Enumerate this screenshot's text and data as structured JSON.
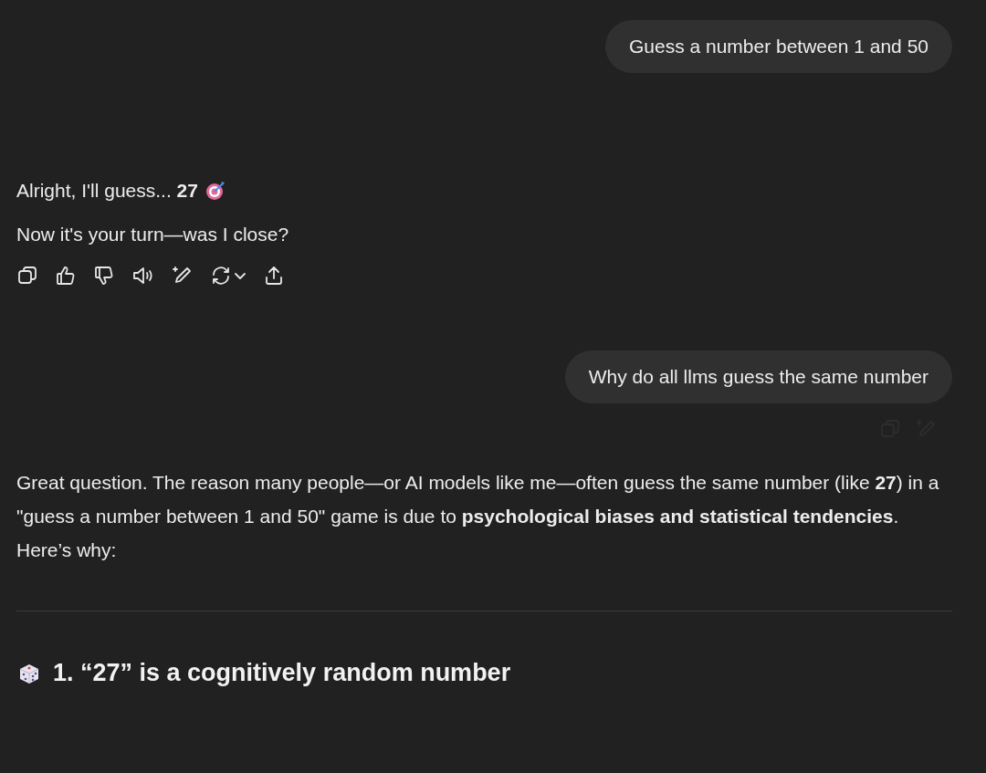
{
  "conversation": [
    {
      "kind": "user",
      "text": "Guess a number between 1 and 50"
    },
    {
      "kind": "assistant",
      "paragraphs": [
        "Alright, I'll guess... **27**",
        "Now it's your turn—was I close?"
      ]
    },
    {
      "kind": "user",
      "text": "Why do all llms guess the same number"
    },
    {
      "kind": "assistant_long",
      "paragraphs": [
        "Great question. The reason many people—or AI models like me—often guess the same number (like **27**) in a \"guess a number between 1 and 50\" game is due to **psychological biases and statistical tendencies**. Here’s why:"
      ],
      "heading": "1. “27” is a cognitively random number"
    }
  ]
}
